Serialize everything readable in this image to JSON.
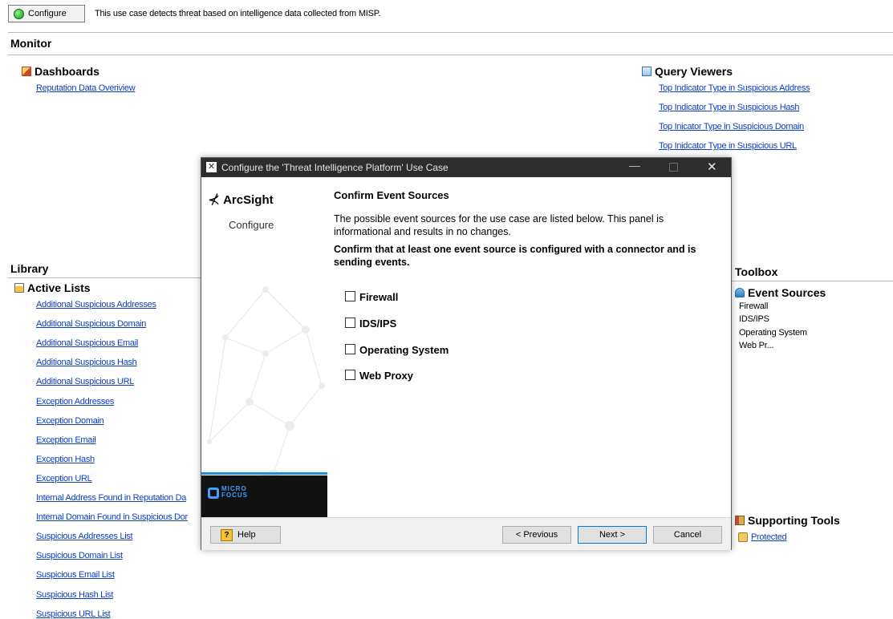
{
  "topbar": {
    "configure_label": "Configure",
    "description": "This use case detects threat based on intelligence data collected from MISP."
  },
  "monitor": {
    "heading": "Monitor",
    "dashboards": {
      "heading": "Dashboards",
      "items": [
        "Reputation Data Overiview"
      ]
    },
    "query_viewers": {
      "heading": "Query Viewers",
      "items": [
        "Top Indicator Type in Suspicious Address",
        "Top Indicator Type in Suspicious Hash",
        "Top Inicator Type in Suspicious Domain",
        "Top Inidcator Type in Suspicious URL"
      ]
    }
  },
  "library": {
    "heading": "Library",
    "active_lists": {
      "heading": "Active Lists",
      "items": [
        "Additional Suspicious Addresses",
        "Additional Suspicious Domain",
        "Additional Suspicious Email",
        "Additional Suspicious Hash",
        "Additional Suspicious URL",
        "Exception Addresses",
        "Exception Domain",
        "Exception Email",
        "Exception Hash",
        "Exception URL",
        "Internal Address Found in Reputation Da",
        "Internal Domain Found in Suspicious Dor",
        "Suspicious Addresses List",
        "Suspicious Domain List",
        "Suspicious Email List",
        "Suspicious Hash List",
        "Suspicious URL List"
      ]
    }
  },
  "toolbox": {
    "heading": "Toolbox",
    "event_sources": {
      "heading": "Event Sources",
      "items": [
        "Firewall",
        "IDS/IPS",
        "Operating System",
        "Web Pr..."
      ]
    },
    "supporting_tools": {
      "heading": "Supporting Tools",
      "items": [
        "Protected"
      ]
    }
  },
  "dialog": {
    "title": "Configure the 'Threat Intelligence Platform' Use Case",
    "brand": "ArcSight",
    "step": "Configure",
    "vendor_line1": "MICRO",
    "vendor_line2": "FOCUS",
    "heading": "Confirm Event Sources",
    "description": "The possible event sources for the use case are listed below. This panel is informational and results in no changes.",
    "instruction": "Confirm that at least one event source is configured with a connector and is sending events.",
    "options": [
      {
        "label": "Firewall",
        "checked": false
      },
      {
        "label": "IDS/IPS",
        "checked": false
      },
      {
        "label": "Operating System",
        "checked": false
      },
      {
        "label": "Web Proxy",
        "checked": false
      }
    ],
    "buttons": {
      "help": "Help",
      "previous": "< Previous",
      "next": "Next >",
      "cancel": "Cancel"
    }
  },
  "colors": {
    "link": "#0b3cc9",
    "titlebar": "#2d2d2d",
    "accent_blue": "#1e90d8"
  }
}
